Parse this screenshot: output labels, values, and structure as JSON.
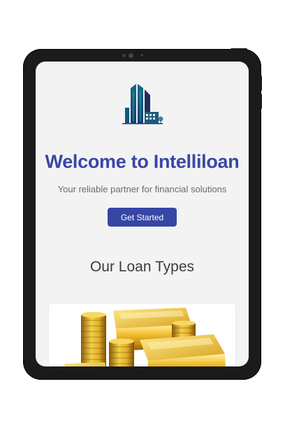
{
  "app": {
    "title": "Welcome to Intelliloan",
    "subtitle": "Your reliable partner for financial solutions",
    "cta_label": "Get Started"
  },
  "loan_types": {
    "heading": "Our Loan Types"
  },
  "colors": {
    "primary": "#3546a5",
    "title": "#3a46a6",
    "screen_bg": "#f3f3f4",
    "device_frame": "#1b1b1b"
  },
  "icons": {
    "logo": "building-logo-icon",
    "card_image": "gold-bars-coins-image"
  }
}
